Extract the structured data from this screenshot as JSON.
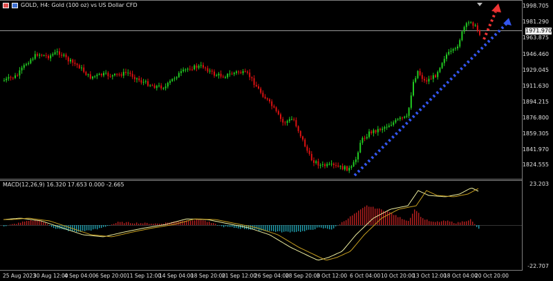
{
  "header": {
    "title": "GOLD, H4:  Gold (100 oz) vs US Dollar CFD",
    "icons": [
      "chart-window-icon",
      "restore-icon"
    ]
  },
  "macd": {
    "title": "MACD(12,26,9) 16.320 17.653 0.000 -2.665",
    "scale_top": "23.203",
    "scale_bottom": "-22.707"
  },
  "price_axis": [
    "1998.705",
    "1981.290",
    "1963.875",
    "1946.460",
    "1929.045",
    "1911.630",
    "1894.215",
    "1876.800",
    "1859.305",
    "1841.970",
    "1824.555"
  ],
  "current_price": "1971.970",
  "time_axis": [
    "25 Aug 2023",
    "30 Aug 12:00",
    "4 Sep 04:00",
    "6 Sep 20:00",
    "11 Sep 12:00",
    "14 Sep 04:00",
    "18 Sep 20:00",
    "21 Sep 12:00",
    "26 Sep 04:00",
    "28 Sep 20:00",
    "3 Oct 12:00",
    "6 Oct 04:00",
    "10 Oct 20:00",
    "13 Oct 12:00",
    "18 Oct 04:00",
    "20 Oct 20:00"
  ],
  "colors": {
    "bull": "#22cc22",
    "bear": "#dd1111",
    "trendline": "#3355ee",
    "arrow": "#ee3333",
    "macd_up": "#b82020",
    "macd_down": "#20a0b0",
    "macd_line": "#f0f0a0",
    "signal_line": "#c8a020"
  }
}
